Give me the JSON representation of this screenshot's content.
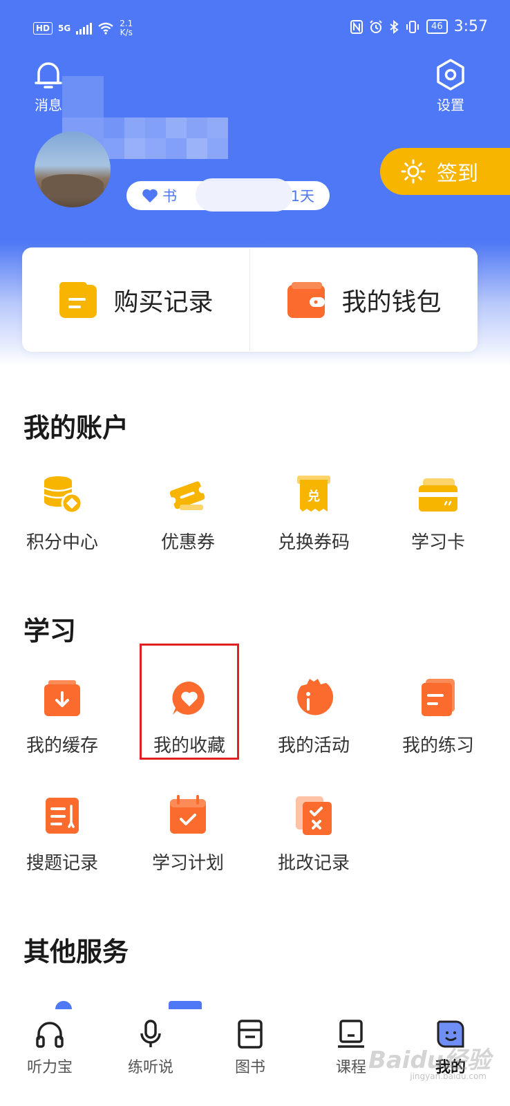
{
  "colors": {
    "header_blue": "#4e78f5",
    "accent_orange": "#fa6b2d",
    "checkin_yellow": "#f7b500",
    "highlight_red": "#e02020"
  },
  "status_bar": {
    "hd": "HD",
    "network": "5G",
    "speed_value": "2.1",
    "speed_unit": "K/s",
    "battery": "46",
    "time": "3:57"
  },
  "header": {
    "messages_label": "消息",
    "settings_label": "设置",
    "badge_prefix": "书",
    "badge_suffix": "1天",
    "checkin_label": "签到"
  },
  "quick_actions": [
    {
      "label": "购买记录",
      "icon": "purchase-record-icon"
    },
    {
      "label": "我的钱包",
      "icon": "wallet-icon"
    }
  ],
  "account": {
    "title": "我的账户",
    "items": [
      {
        "label": "积分中心",
        "icon": "points-coins-icon"
      },
      {
        "label": "优惠券",
        "icon": "coupon-ticket-icon"
      },
      {
        "label": "兑换券码",
        "icon": "redeem-code-icon"
      },
      {
        "label": "学习卡",
        "icon": "study-card-icon"
      }
    ]
  },
  "study": {
    "title": "学习",
    "items": [
      {
        "label": "我的缓存",
        "icon": "download-cache-icon"
      },
      {
        "label": "我的收藏",
        "icon": "favorite-heart-icon",
        "highlighted": true
      },
      {
        "label": "我的活动",
        "icon": "activity-icon"
      },
      {
        "label": "我的练习",
        "icon": "practice-icon"
      },
      {
        "label": "搜题记录",
        "icon": "search-question-icon"
      },
      {
        "label": "学习计划",
        "icon": "study-plan-icon"
      },
      {
        "label": "批改记录",
        "icon": "correction-record-icon"
      }
    ]
  },
  "other": {
    "title": "其他服务"
  },
  "tabbar": {
    "active": "我的",
    "tabs": [
      {
        "label": "听力宝",
        "icon": "headphones-icon"
      },
      {
        "label": "练听说",
        "icon": "microphone-icon"
      },
      {
        "label": "图书",
        "icon": "book-icon"
      },
      {
        "label": "课程",
        "icon": "course-icon"
      },
      {
        "label": "我的",
        "icon": "profile-face-icon"
      }
    ]
  },
  "watermark": {
    "text": "Baidu经验",
    "sub": "jingyan.baidu.com"
  }
}
